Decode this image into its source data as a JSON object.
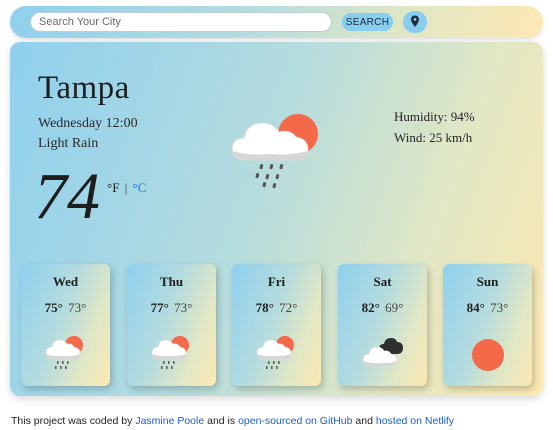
{
  "search": {
    "placeholder": "Search Your City",
    "button_label": "SEARCH"
  },
  "current": {
    "city": "Tampa",
    "date": "Wednesday 12:00",
    "description": "Light Rain",
    "temperature": "74",
    "unit_f": "°F",
    "separator": "|",
    "unit_c": "°C",
    "humidity": "Humidity: 94%",
    "wind": "Wind: 25 km/h",
    "icon": "rain-cloud-sun-icon"
  },
  "forecast": [
    {
      "day": "Wed",
      "high": "75°",
      "low": "73°",
      "icon": "rain-cloud-sun-icon"
    },
    {
      "day": "Thu",
      "high": "77°",
      "low": "73°",
      "icon": "rain-cloud-sun-icon"
    },
    {
      "day": "Fri",
      "high": "78°",
      "low": "72°",
      "icon": "rain-cloud-sun-icon"
    },
    {
      "day": "Sat",
      "high": "82°",
      "low": "69°",
      "icon": "cloudy-icon"
    },
    {
      "day": "Sun",
      "high": "84°",
      "low": "73°",
      "icon": "sun-icon"
    }
  ],
  "footer": {
    "text1": "This project was coded by",
    "author_link": "Jasmine Poole",
    "text2": "and is",
    "github_link": "open-sourced on GitHub",
    "text3": "and",
    "netlify_link": "hosted on Netlify"
  },
  "colors": {
    "accent": "#86cdf0",
    "sun": "#f4694a",
    "link": "#1a73e8"
  }
}
